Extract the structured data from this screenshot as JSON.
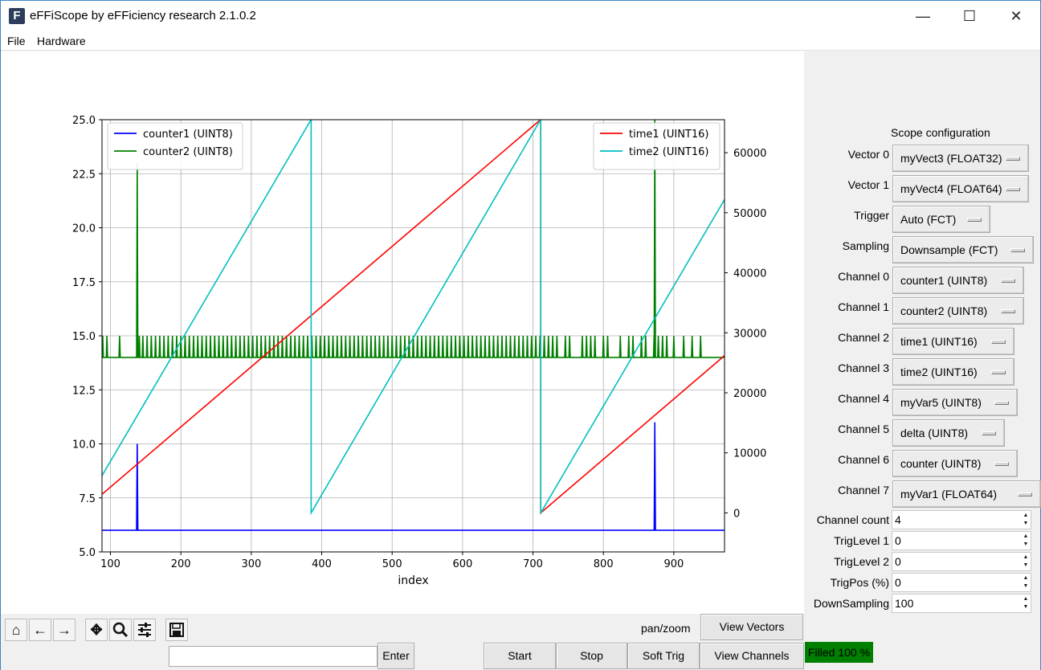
{
  "window": {
    "title": "eFFiScope by eFFiciency research 2.1.0.2",
    "app_icon": "F",
    "minimize": "—",
    "maximize": "☐",
    "close": "✕"
  },
  "menu": {
    "file": "File",
    "hardware": "Hardware"
  },
  "chart_data": {
    "type": "line",
    "xlabel": "index",
    "xlim": [
      88,
      972
    ],
    "x_ticks": [
      "100",
      "200",
      "300",
      "400",
      "500",
      "600",
      "700",
      "800",
      "900"
    ],
    "ylim_left": [
      5.0,
      25.0
    ],
    "left_ticks": [
      "5.0",
      "7.5",
      "10.0",
      "12.5",
      "15.0",
      "17.5",
      "20.0",
      "22.5",
      "25.0"
    ],
    "ylim_right": [
      -6500,
      65500
    ],
    "right_ticks": [
      "0",
      "10000",
      "20000",
      "30000",
      "40000",
      "50000",
      "60000"
    ],
    "grid": true,
    "legend_left_placement": "top-left",
    "legend_right_placement": "top-right",
    "series": [
      {
        "name": "counter1 (UINT8)",
        "axis": "left",
        "color": "#0000ff",
        "baseline": 6,
        "spikes": [
          {
            "x": 138,
            "y": 10
          },
          {
            "x": 873,
            "y": 11
          }
        ]
      },
      {
        "name": "counter2 (UINT8)",
        "axis": "left",
        "color": "#008000",
        "baseline": 14,
        "pulse_level": 15,
        "pulses": [
          89,
          95,
          113,
          141,
          146,
          152,
          158,
          164,
          170,
          176,
          182,
          188,
          194,
          200,
          206,
          212,
          218,
          224,
          230,
          236,
          242,
          248,
          254,
          260,
          266,
          272,
          278,
          284,
          290,
          296,
          302,
          308,
          314,
          320,
          326,
          332,
          338,
          344,
          350,
          356,
          362,
          368,
          374,
          380,
          386,
          392,
          398,
          404,
          410,
          416,
          422,
          428,
          434,
          440,
          446,
          452,
          458,
          464,
          470,
          476,
          482,
          488,
          494,
          500,
          506,
          512,
          518,
          524,
          530,
          536,
          542,
          548,
          554,
          560,
          566,
          572,
          578,
          584,
          590,
          596,
          602,
          608,
          614,
          620,
          626,
          632,
          638,
          644,
          650,
          656,
          662,
          668,
          674,
          680,
          686,
          692,
          698,
          704,
          710,
          716,
          722,
          728,
          734,
          746,
          752,
          770,
          776,
          782,
          788,
          800,
          806,
          824,
          836,
          842,
          854,
          860,
          872,
          878,
          884,
          890,
          900,
          914,
          926,
          938
        ],
        "spikes": [
          {
            "x": 138,
            "y": 23
          },
          {
            "x": 873,
            "y": 25
          }
        ]
      },
      {
        "name": "time1 (UINT16)",
        "axis": "right",
        "color": "#ff0000",
        "points": [
          [
            88,
            3100
          ],
          [
            711,
            65535
          ],
          [
            711,
            0
          ],
          [
            972,
            26200
          ]
        ]
      },
      {
        "name": "time2 (UINT16)",
        "axis": "right",
        "color": "#00bfbf",
        "points": [
          [
            88,
            6200
          ],
          [
            385,
            65535
          ],
          [
            385,
            0
          ],
          [
            711,
            65535
          ],
          [
            711,
            0
          ],
          [
            972,
            52200
          ]
        ]
      }
    ]
  },
  "config": {
    "title": "Scope  configuration",
    "rows": [
      {
        "label": "Vector 0",
        "value": "myVect3 (FLOAT32)"
      },
      {
        "label": "Vector 1",
        "value": "myVect4 (FLOAT64)"
      },
      {
        "label": "Trigger",
        "value": "Auto (FCT)"
      },
      {
        "label": "Sampling",
        "value": "Downsample (FCT)"
      },
      {
        "label": "Channel 0",
        "value": "counter1 (UINT8)"
      },
      {
        "label": "Channel 1",
        "value": "counter2 (UINT8)"
      },
      {
        "label": "Channel 2",
        "value": "time1 (UINT16)"
      },
      {
        "label": "Channel 3",
        "value": "time2 (UINT16)"
      },
      {
        "label": "Channel 4",
        "value": "myVar5 (UINT8)"
      },
      {
        "label": "Channel 5",
        "value": "delta (UINT8)"
      },
      {
        "label": "Channel 6",
        "value": "counter (UINT8)"
      },
      {
        "label": "Channel 7",
        "value": "myVar1 (FLOAT64)"
      }
    ],
    "spins": [
      {
        "label": "Channel count",
        "value": "4"
      },
      {
        "label": "TrigLevel 1",
        "value": "0"
      },
      {
        "label": "TrigLevel 2",
        "value": "0"
      },
      {
        "label": "TrigPos (%)",
        "value": "0"
      },
      {
        "label": "DownSampling",
        "value": "100"
      }
    ]
  },
  "toolbar": {
    "icons": [
      "home-icon",
      "back-icon",
      "forward-icon",
      "pan-icon",
      "zoom-icon",
      "configure-icon",
      "save-icon"
    ],
    "mode": "pan/zoom",
    "enter": "Enter",
    "start": "Start",
    "stop": "Stop",
    "soft_trig": "Soft Trig",
    "view_vectors": "View Vectors",
    "view_channels": "View Channels",
    "status": "Filled 100 %"
  }
}
